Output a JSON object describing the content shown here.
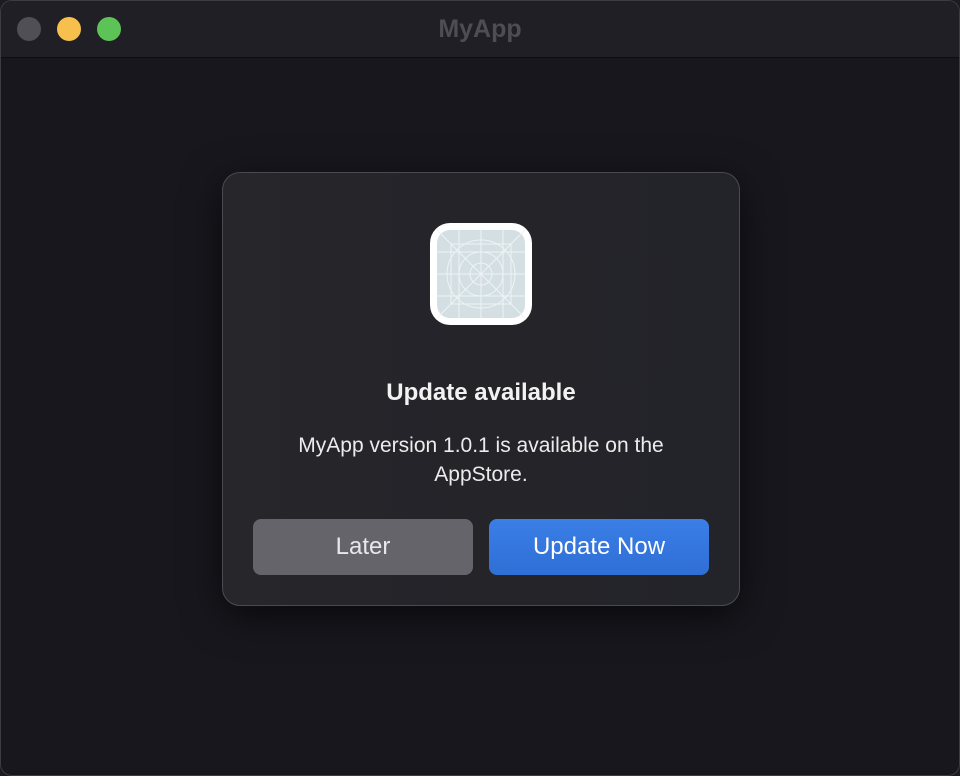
{
  "window": {
    "title": "MyApp"
  },
  "dialog": {
    "icon": "app-placeholder-icon",
    "title": "Update available",
    "message": "MyApp version 1.0.1 is available on the AppStore.",
    "buttons": {
      "later_label": "Later",
      "update_label": "Update Now"
    }
  },
  "colors": {
    "accent": "#3479e0",
    "close_light": "#4f4f55",
    "minimize_light": "#f7c04d",
    "maximize_light": "#5dc356"
  }
}
